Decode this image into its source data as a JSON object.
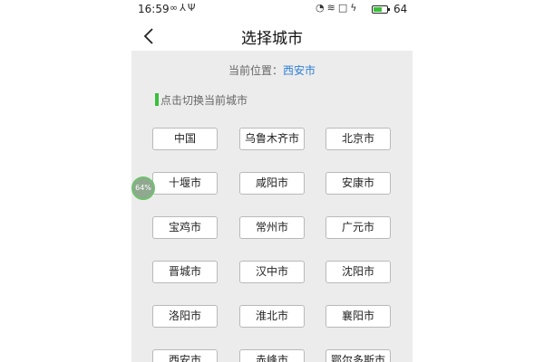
{
  "status_bar": {
    "time": "16:59",
    "left_icons": [
      "infinity-icon",
      "share-icon",
      "usb-icon"
    ],
    "right_icons": [
      "alarm-icon",
      "wifi-icon",
      "square-icon",
      "charging-icon"
    ],
    "battery_level": 0.64,
    "battery_text": "64"
  },
  "header": {
    "title": "选择城市",
    "back_icon": "chevron-left-icon"
  },
  "location": {
    "label": "当前位置：",
    "city": "西安市"
  },
  "hint": {
    "text": "点击切换当前城市"
  },
  "cities": [
    "中国",
    "乌鲁木齐市",
    "北京市",
    "十堰市",
    "咸阳市",
    "安康市",
    "宝鸡市",
    "常州市",
    "广元市",
    "晋城市",
    "汉中市",
    "沈阳市",
    "洛阳市",
    "淮北市",
    "襄阳市",
    "西安市",
    "赤峰市",
    "鄂尔多斯市"
  ],
  "floating_badge": {
    "text": "64%"
  },
  "colors": {
    "accent_blue": "#2f7fd6",
    "accent_green": "#3bbf3b",
    "content_bg": "#ececec"
  }
}
